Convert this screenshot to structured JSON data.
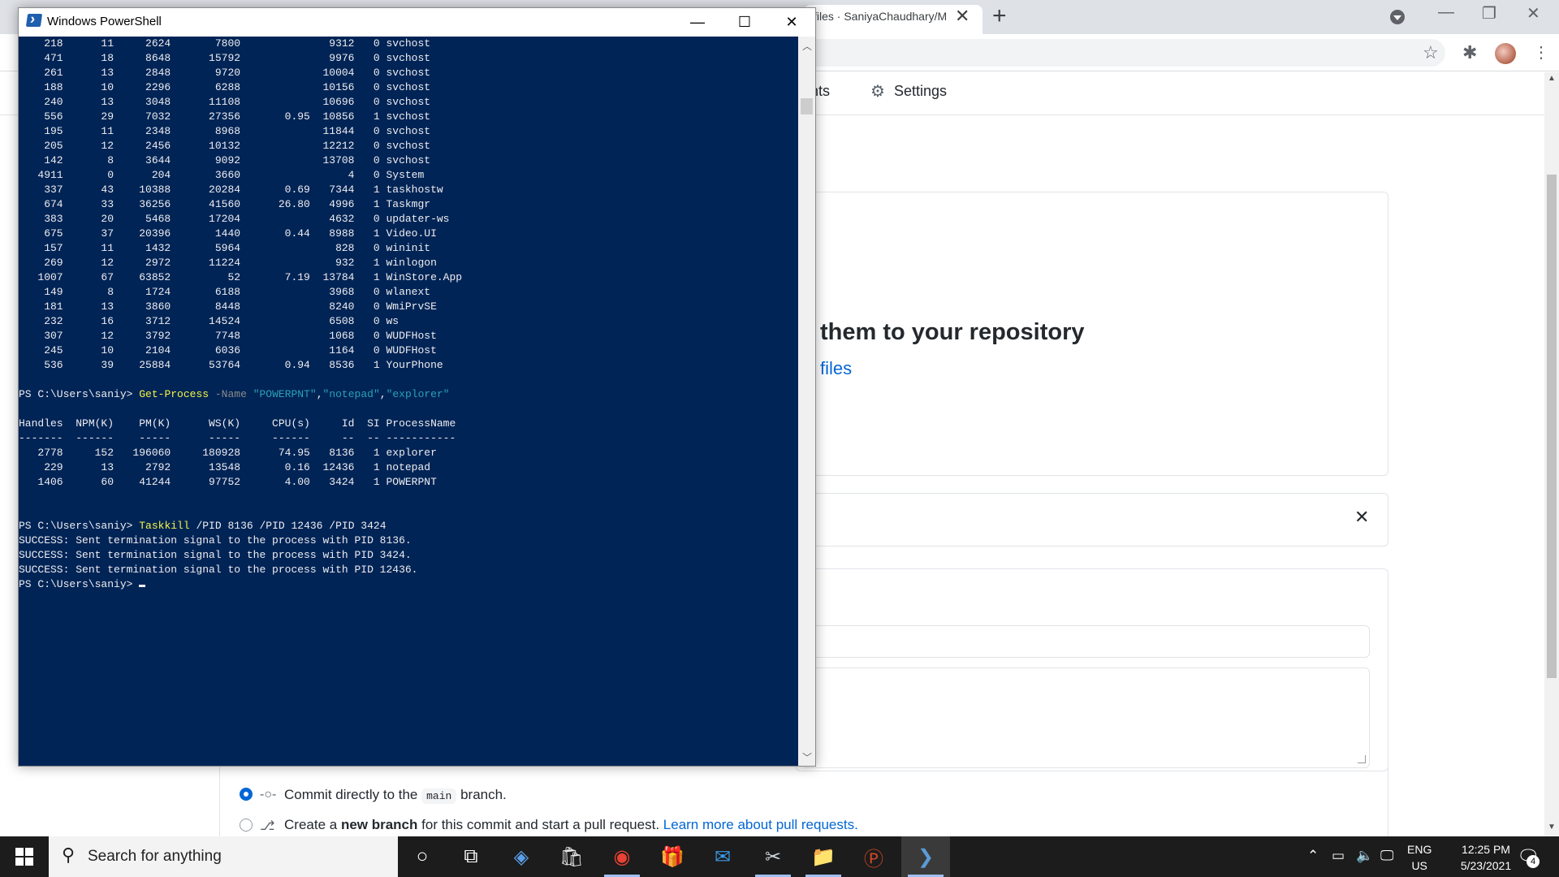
{
  "browser": {
    "tab_title": "files · SaniyaChaudhary/M",
    "tab_close": "✕",
    "new_tab": "+",
    "nav": {
      "insights": "Insights",
      "settings": "Settings"
    },
    "hero_title": "them to your repository",
    "hero_link": "files",
    "card_close": "✕",
    "commit_options": [
      {
        "pre": "Commit directly to the",
        "code": "main",
        "post": "branch."
      },
      {
        "pre": "Create a",
        "bold": "new branch",
        "post": "for this commit and start a pull request.",
        "link": "Learn more about pull requests."
      }
    ]
  },
  "powershell": {
    "title": "Windows PowerShell",
    "process_rows": [
      "    218      11     2624       7800              9312   0 svchost",
      "    471      18     8648      15792              9976   0 svchost",
      "    261      13     2848       9720             10004   0 svchost",
      "    188      10     2296       6288             10156   0 svchost",
      "    240      13     3048      11108             10696   0 svchost",
      "    556      29     7032      27356       0.95  10856   1 svchost",
      "    195      11     2348       8968             11844   0 svchost",
      "    205      12     2456      10132             12212   0 svchost",
      "    142       8     3644       9092             13708   0 svchost",
      "   4911       0      204       3660                 4   0 System",
      "    337      43    10388      20284       0.69   7344   1 taskhostw",
      "    674      33    36256      41560      26.80   4996   1 Taskmgr",
      "    383      20     5468      17204              4632   0 updater-ws",
      "    675      37    20396       1440       0.44   8988   1 Video.UI",
      "    157      11     1432       5964               828   0 wininit",
      "    269      12     2972      11224               932   1 winlogon",
      "   1007      67    63852         52       7.19  13784   1 WinStore.App",
      "    149       8     1724       6188              3968   0 wlanext",
      "    181      13     3860       8448              8240   0 WmiPrvSE",
      "    232      16     3712      14524              6508   0 ws",
      "    307      12     3792       7748              1068   0 WUDFHost",
      "    245      10     2104       6036              1164   0 WUDFHost",
      "    536      39    25884      53764       0.94   8536   1 YourPhone"
    ],
    "prompt": "PS C:\\Users\\saniy> ",
    "cmd1": {
      "name": "Get-Process",
      "param": "-Name",
      "a1": "\"POWERPNT\"",
      "a2": "\"notepad\"",
      "a3": "\"explorer\""
    },
    "table_header": "Handles  NPM(K)    PM(K)      WS(K)     CPU(s)     Id  SI ProcessName",
    "table_rule": "-------  ------    -----      -----     ------     --  -- -----------",
    "table_rows": [
      "   2778     152   196060     180928      74.95   8136   1 explorer",
      "    229      13     2792      13548       0.16  12436   1 notepad",
      "   1406      60    41244      97752       4.00   3424   1 POWERPNT"
    ],
    "cmd2": {
      "name": "Taskkill",
      "args": " /PID 8136 /PID 12436 /PID 3424"
    },
    "results": [
      "SUCCESS: Sent termination signal to the process with PID 8136.",
      "SUCCESS: Sent termination signal to the process with PID 3424.",
      "SUCCESS: Sent termination signal to the process with PID 12436."
    ]
  },
  "taskbar": {
    "search_placeholder": "Search for anything",
    "lang_line1": "ENG",
    "lang_line2": "US",
    "time": "12:25 PM",
    "date": "5/23/2021",
    "notification_count": "4"
  }
}
